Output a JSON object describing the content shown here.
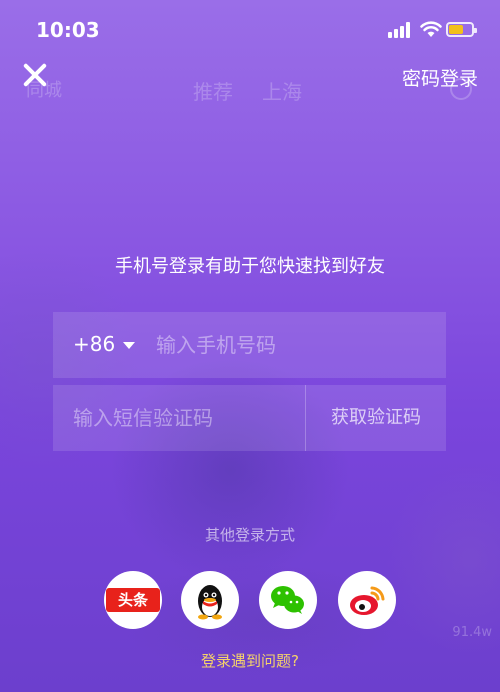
{
  "status_bar": {
    "time": "10:03"
  },
  "background_feed": {
    "left_label": "同城",
    "tabs": [
      "推荐",
      "上海"
    ],
    "like_count": "91.4w"
  },
  "header": {
    "password_login": "密码登录"
  },
  "subtitle": "手机号登录有助于您快速找到好友",
  "form": {
    "country_code": "+86",
    "phone_placeholder": "输入手机号码",
    "code_placeholder": "输入短信验证码",
    "get_code_label": "获取验证码"
  },
  "other_login": {
    "title": "其他登录方式",
    "providers": [
      {
        "name": "toutiao",
        "label": "头条",
        "icon": "toutiao-icon"
      },
      {
        "name": "qq",
        "icon": "qq-icon"
      },
      {
        "name": "wechat",
        "icon": "wechat-icon"
      },
      {
        "name": "weibo",
        "icon": "weibo-icon"
      }
    ]
  },
  "help_link": "登录遇到问题?",
  "colors": {
    "accent_yellow": "#f5d26a",
    "toutiao_red": "#e8221b",
    "wechat_green": "#2dc100",
    "weibo_red": "#e6162d"
  }
}
